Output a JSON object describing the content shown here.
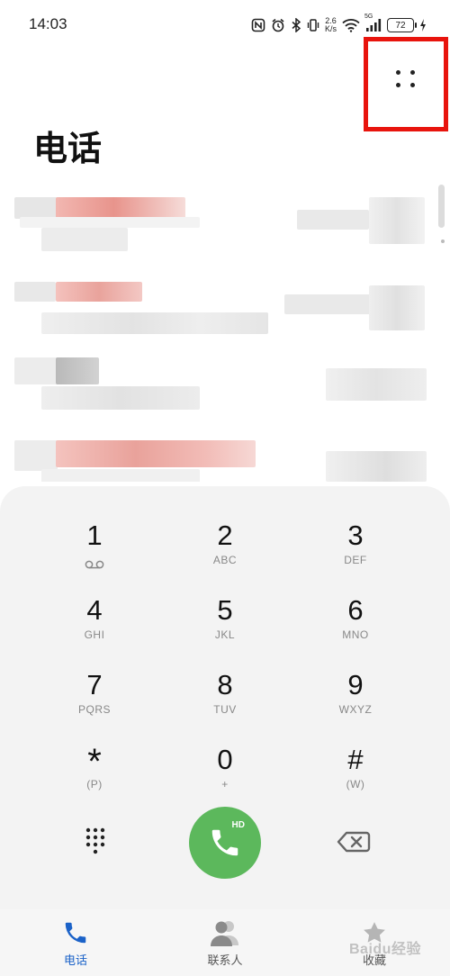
{
  "status": {
    "time": "14:03",
    "net_speed_value": "2.6",
    "net_speed_unit": "K/s",
    "network_type": "5G",
    "battery_level": "72"
  },
  "header": {
    "title": "电话"
  },
  "dialpad": {
    "keys": [
      {
        "digit": "1",
        "letters": ""
      },
      {
        "digit": "2",
        "letters": "ABC"
      },
      {
        "digit": "3",
        "letters": "DEF"
      },
      {
        "digit": "4",
        "letters": "GHI"
      },
      {
        "digit": "5",
        "letters": "JKL"
      },
      {
        "digit": "6",
        "letters": "MNO"
      },
      {
        "digit": "7",
        "letters": "PQRS"
      },
      {
        "digit": "8",
        "letters": "TUV"
      },
      {
        "digit": "9",
        "letters": "WXYZ"
      },
      {
        "digit": "*",
        "letters": "(P)"
      },
      {
        "digit": "0",
        "letters": "+"
      },
      {
        "digit": "#",
        "letters": "(W)"
      }
    ],
    "call_badge": "HD"
  },
  "nav": {
    "items": [
      {
        "label": "电话",
        "icon": "phone-icon",
        "active": true
      },
      {
        "label": "联系人",
        "icon": "contacts-icon",
        "active": false
      },
      {
        "label": "收藏",
        "icon": "star-icon",
        "active": false
      }
    ]
  },
  "watermark": "Baidu经验",
  "colors": {
    "accent": "#1b62c8",
    "call_green": "#5cb85c",
    "highlight_red": "#e8140d"
  }
}
